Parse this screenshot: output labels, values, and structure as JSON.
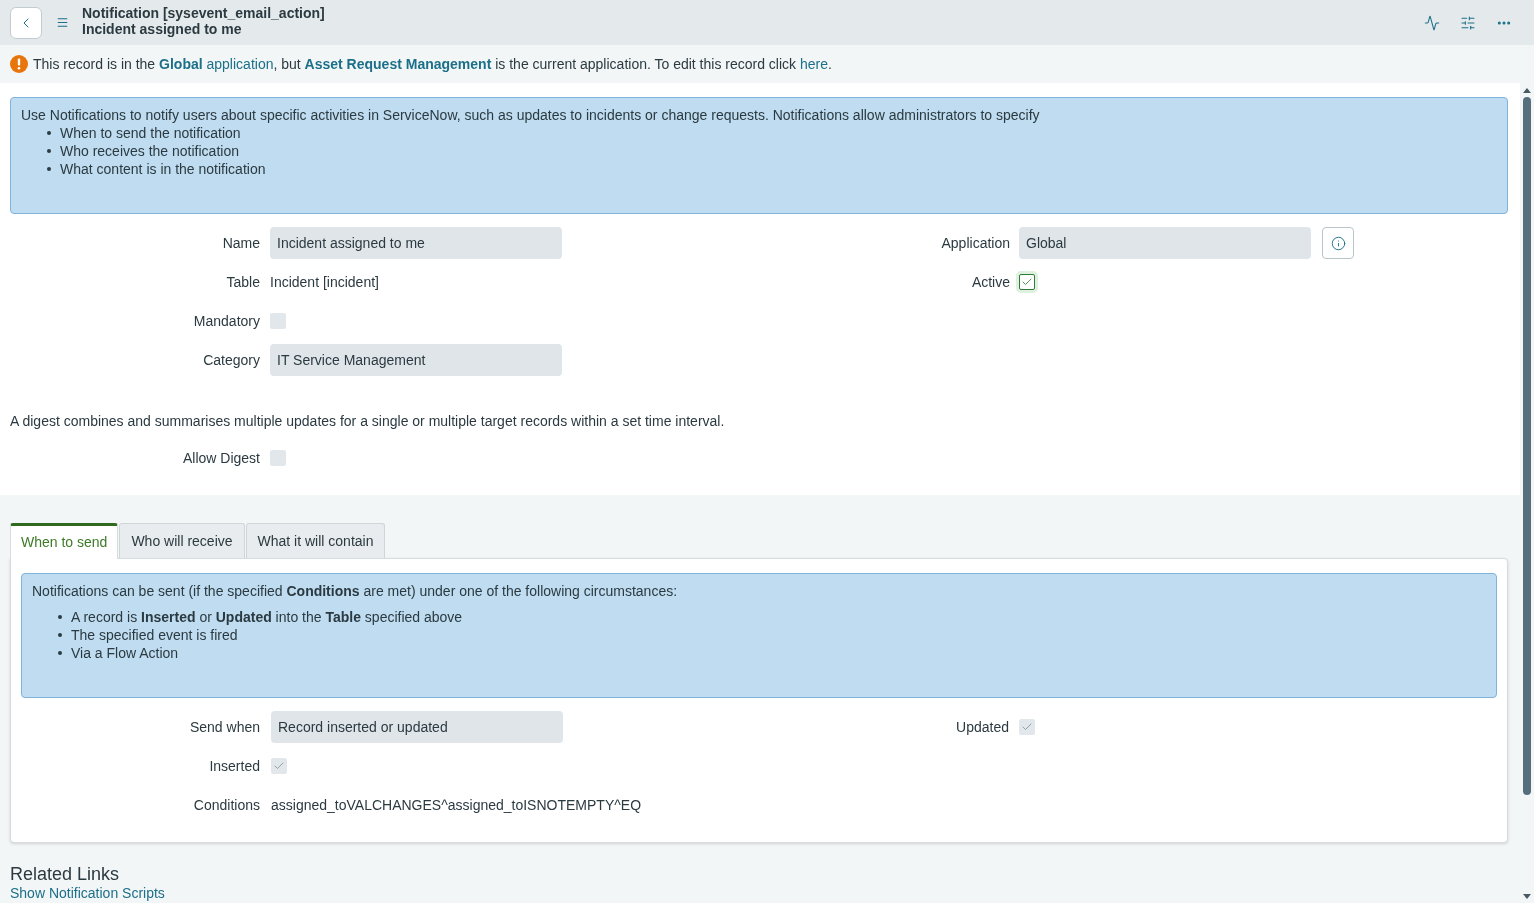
{
  "header": {
    "title": "Notification [sysevent_email_action]",
    "subtitle": "Incident assigned to me"
  },
  "notice": {
    "segments": [
      {
        "kind": "text",
        "text": "This record is in the "
      },
      {
        "kind": "link",
        "bold": false,
        "text": "**Global** application"
      },
      {
        "kind": "text",
        "text": ", but "
      },
      {
        "kind": "link",
        "bold": true,
        "text": "Asset Request Management"
      },
      {
        "kind": "text",
        "text": " is the current application. To edit this record click "
      },
      {
        "kind": "link",
        "bold": false,
        "text": "here"
      },
      {
        "kind": "text",
        "text": "."
      }
    ]
  },
  "intro_box": {
    "text": "Use Notifications to notify users about specific activities in ServiceNow, such as updates to incidents or change requests. Notifications allow administrators to specify",
    "bullets": [
      "When to send the notification",
      "Who receives the notification",
      "What content is in the notification"
    ]
  },
  "form": {
    "left": [
      {
        "label": "Name",
        "kind": "input",
        "value": "Incident assigned to me"
      },
      {
        "label": "Table",
        "kind": "text",
        "value": "Incident [incident]"
      },
      {
        "label": "Mandatory",
        "kind": "checkbox",
        "checked": false,
        "disabled": true
      },
      {
        "label": "Category",
        "kind": "input",
        "value": "IT Service Management"
      }
    ],
    "right": [
      {
        "label": "Application",
        "kind": "input",
        "value": "Global",
        "info_button": true
      },
      {
        "label": "Active",
        "kind": "checkbox",
        "checked": true,
        "disabled": false
      }
    ]
  },
  "digest": {
    "text": "A digest combines and summarises multiple updates for a single or multiple target records within a set time interval.",
    "fields": [
      {
        "label": "Allow Digest",
        "kind": "checkbox",
        "checked": false,
        "disabled": true
      }
    ]
  },
  "tabs": [
    {
      "label": "When to send",
      "selected": true
    },
    {
      "label": "Who will receive",
      "selected": false
    },
    {
      "label": "What it will contain",
      "selected": false
    }
  ],
  "tab_panel": {
    "info_box": {
      "text": "Notifications can be sent (if the specified **Conditions** are met) under one of the following circumstances:",
      "bullets": [
        "A record is **Inserted** or **Updated** into the **Table** specified above",
        "The specified event is fired",
        "Via a Flow Action"
      ]
    },
    "left": [
      {
        "label": "Send when",
        "kind": "input",
        "value": "Record inserted or updated"
      },
      {
        "label": "Inserted",
        "kind": "checkbox",
        "checked": true,
        "disabled": true
      },
      {
        "label": "Conditions",
        "kind": "text",
        "value": "assigned_toVALCHANGES^assigned_toISNOTEMPTY^EQ"
      }
    ],
    "right": [
      {
        "label": "Updated",
        "kind": "checkbox",
        "checked": true,
        "disabled": true
      }
    ]
  },
  "related_links": {
    "title": "Related Links",
    "links": [
      "Show Notification Scripts"
    ]
  }
}
